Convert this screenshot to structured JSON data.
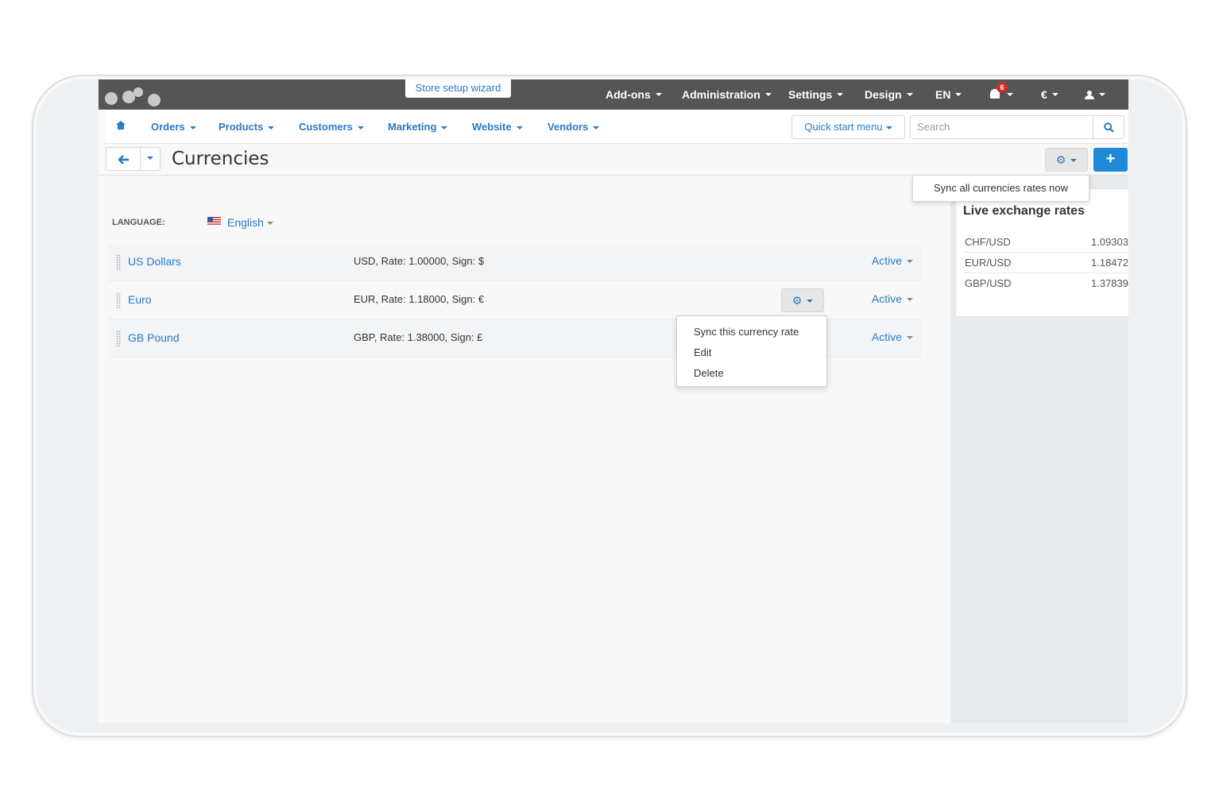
{
  "topbar": {
    "wizard_label": "Store setup wizard",
    "menu": [
      {
        "label": "Add-ons"
      },
      {
        "label": "Administration"
      },
      {
        "label": "Settings"
      },
      {
        "label": "Design"
      },
      {
        "label": "EN"
      }
    ],
    "notifications_count": "6",
    "currency": "€"
  },
  "subnav": {
    "items": [
      "Orders",
      "Products",
      "Customers",
      "Marketing",
      "Website",
      "Vendors"
    ],
    "quick_start": "Quick start menu",
    "search_placeholder": "Search"
  },
  "page": {
    "title": "Currencies",
    "sync_all_label": "Sync all currencies rates now",
    "language_label": "LANGUAGE:",
    "language_value": "English"
  },
  "currencies": [
    {
      "name": "US Dollars",
      "info": "USD, Rate: 1.00000, Sign: $",
      "status": "Active"
    },
    {
      "name": "Euro",
      "info": "EUR, Rate: 1.18000, Sign: €",
      "status": "Active"
    },
    {
      "name": "GB Pound",
      "info": "GBP, Rate: 1.38000, Sign: £",
      "status": "Active"
    }
  ],
  "row_menu": [
    "Sync this currency rate",
    "Edit",
    "Delete"
  ],
  "sidebar": {
    "title": "Live exchange rates",
    "rates": [
      {
        "pair": "CHF/USD",
        "value": "1.09303"
      },
      {
        "pair": "EUR/USD",
        "value": "1.18472"
      },
      {
        "pair": "GBP/USD",
        "value": "1.37839"
      }
    ]
  },
  "colors": {
    "accent": "#2a7bc4",
    "topbar": "#555555",
    "primary_button": "#1f89d9",
    "badge": "#c9302c"
  }
}
